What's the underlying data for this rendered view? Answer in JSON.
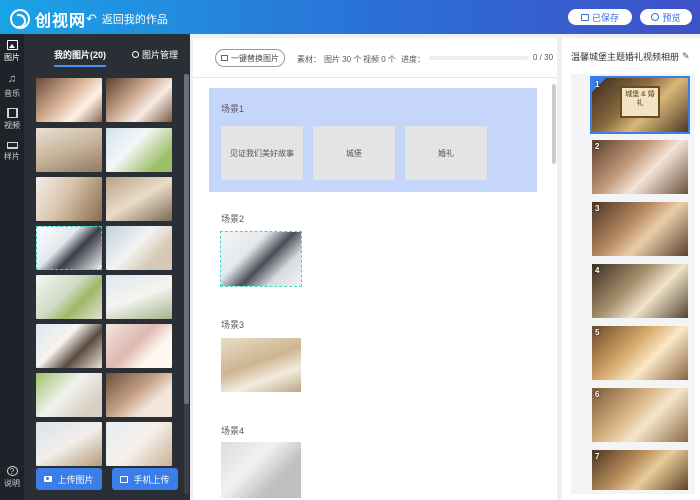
{
  "header": {
    "logo_text": "创视网",
    "back_label": "返回我的作品",
    "saved_label": "已保存",
    "preview_label": "预览"
  },
  "nav": {
    "items": [
      {
        "label": "图片",
        "icon": "image-icon"
      },
      {
        "label": "音乐",
        "icon": "music-icon"
      },
      {
        "label": "视频",
        "icon": "video-icon"
      },
      {
        "label": "样片",
        "icon": "sample-icon"
      }
    ],
    "help_label": "说明"
  },
  "photos": {
    "tab_label": "我的图片(20)",
    "manage_label": "图片管理",
    "upload_label": "上传图片",
    "mobile_upload_label": "手机上传"
  },
  "toolbar": {
    "replace_label": "一键替换图片",
    "material_label": "素材：",
    "images_count": "图片 30 个",
    "videos_count": "视频 0 个",
    "progress_label": "进度：",
    "progress_value": "0 / 30",
    "progress_fraction": 0
  },
  "scenes": [
    {
      "title": "场景1",
      "slots": [
        "见证我们美好故事",
        "城堡",
        "婚礼"
      ]
    },
    {
      "title": "场景2"
    },
    {
      "title": "场景3"
    },
    {
      "title": "场景4"
    }
  ],
  "album": {
    "title": "温馨城堡主题婚礼视频相册",
    "sign_text": "城堡 & 婚礼",
    "frames": [
      "1",
      "2",
      "3",
      "4",
      "5",
      "6",
      "7"
    ]
  },
  "colors": {
    "accent": "#3b7ee8",
    "scene_active": "#c6d6fb",
    "header_gradient_start": "#1aa3e6",
    "header_gradient_end": "#3f51c9"
  }
}
